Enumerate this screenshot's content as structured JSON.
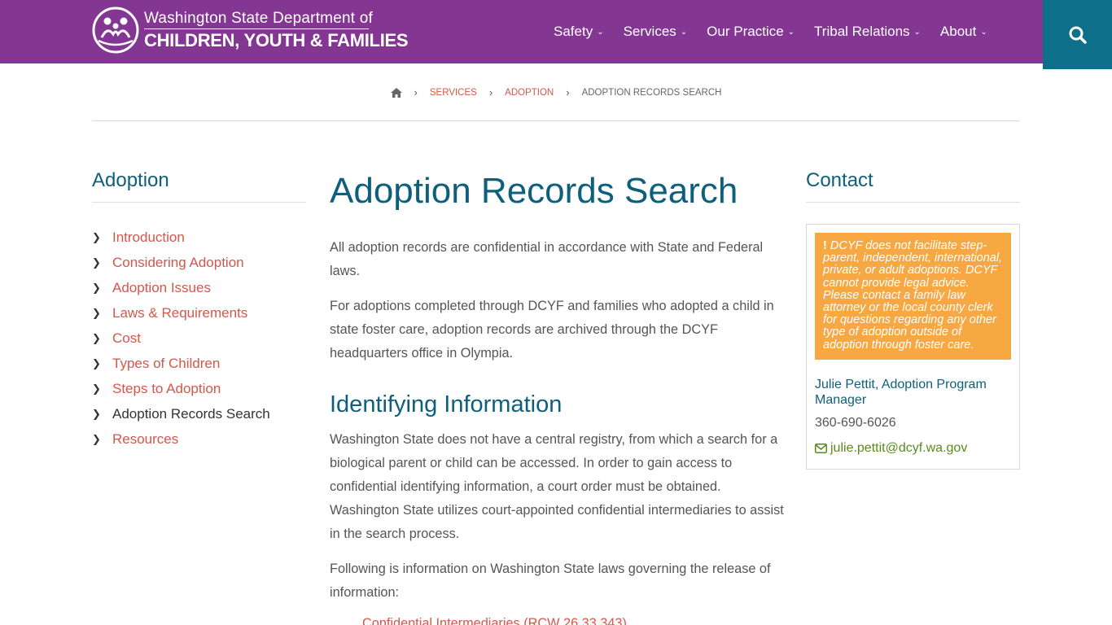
{
  "header": {
    "logo_line1": "Washington State Department of",
    "logo_line2": "CHILDREN, YOUTH & FAMILIES",
    "nav": [
      {
        "label": "Safety"
      },
      {
        "label": "Services"
      },
      {
        "label": "Our Practice"
      },
      {
        "label": "Tribal Relations"
      },
      {
        "label": "About"
      }
    ],
    "colors": {
      "brand": "#833793",
      "search_bg": "#0e6f8a"
    }
  },
  "breadcrumb": {
    "items": [
      "SERVICES",
      "ADOPTION"
    ],
    "current": "ADOPTION RECORDS SEARCH"
  },
  "sidebar": {
    "title": "Adoption",
    "items": [
      {
        "label": "Introduction"
      },
      {
        "label": "Considering Adoption"
      },
      {
        "label": "Adoption Issues"
      },
      {
        "label": "Laws & Requirements"
      },
      {
        "label": "Cost"
      },
      {
        "label": "Types of Children"
      },
      {
        "label": "Steps to Adoption"
      },
      {
        "label": "Adoption Records Search"
      },
      {
        "label": "Resources"
      }
    ]
  },
  "main": {
    "title": "Adoption Records Search",
    "para1": "All adoption records are confidential in accordance with State and Federal laws.",
    "para2": "For adoptions completed through DCYF and families who adopted a child in state foster care, adoption records are archived through the DCYF headquarters office in Olympia.",
    "subheading": "Identifying Information",
    "para3": "Washington State does not have a central registry, from which a search for a biological parent or child can be accessed. In order to gain access to confidential identifying information, a court order must be obtained. Washington State utilizes court-appointed confidential intermediaries to assist in the search process.",
    "para4": "Following is information on Washington State laws governing the release of information:",
    "link1": "Confidential Intermediaries (RCW 26.33.343)"
  },
  "contact": {
    "title": "Contact",
    "notice": "DCYF does not facilitate step-parent, independent, international, private, or adult adoptions. DCYF cannot provide legal advice. Please contact a family law attorney or the local county clerk for questions regarding any other type of adoption outside of adoption through foster care.",
    "person": "Julie Pettit, Adoption Program Manager",
    "phone": "360-690-6026",
    "email": "julie.pettit@dcyf.wa.gov"
  }
}
